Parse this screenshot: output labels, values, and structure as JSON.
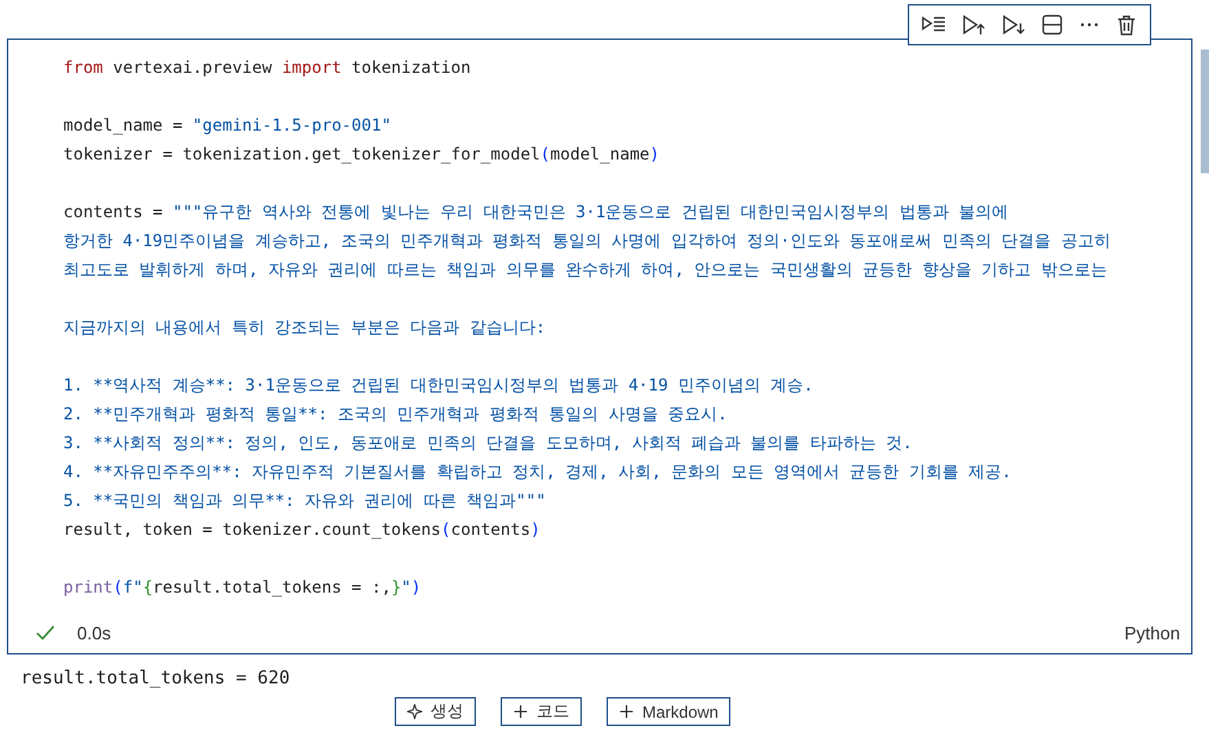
{
  "cell": {
    "lines": [
      {
        "kind": "code",
        "segments": [
          {
            "kind": "keyword",
            "text": "from"
          },
          {
            "kind": "plain",
            "text": " vertexai.preview "
          },
          {
            "kind": "keyword",
            "text": "import"
          },
          {
            "kind": "plain",
            "text": " tokenization"
          }
        ]
      },
      {
        "kind": "blank"
      },
      {
        "kind": "code",
        "segments": [
          {
            "kind": "plain",
            "text": "model_name = "
          },
          {
            "kind": "string",
            "text": "\"gemini-1.5-pro-001\""
          }
        ]
      },
      {
        "kind": "code",
        "segments": [
          {
            "kind": "plain",
            "text": "tokenizer = tokenization.get_tokenizer_for_model"
          },
          {
            "kind": "paren",
            "text": "("
          },
          {
            "kind": "plain",
            "text": "model_name"
          },
          {
            "kind": "paren",
            "text": ")"
          }
        ]
      },
      {
        "kind": "blank"
      },
      {
        "kind": "code",
        "segments": [
          {
            "kind": "plain",
            "text": "contents = "
          },
          {
            "kind": "string",
            "text": "\"\"\"유구한 역사와 전통에 빛나는 우리 대한국민은 3·1운동으로 건립된 대한민국임시정부의 법통과 불의에"
          }
        ]
      },
      {
        "kind": "code",
        "segments": [
          {
            "kind": "string",
            "text": "항거한 4·19민주이념을 계승하고, 조국의 민주개혁과 평화적 통일의 사명에 입각하여 정의·인도와 동포애로써 민족의 단결을 공고히"
          }
        ]
      },
      {
        "kind": "code",
        "segments": [
          {
            "kind": "string",
            "text": "최고도로 발휘하게 하며, 자유와 권리에 따르는 책임과 의무를 완수하게 하여, 안으로는 국민생활의 균등한 향상을 기하고 밖으로는"
          }
        ]
      },
      {
        "kind": "blank"
      },
      {
        "kind": "code",
        "segments": [
          {
            "kind": "string",
            "text": "지금까지의 내용에서 특히 강조되는 부분은 다음과 같습니다:"
          }
        ]
      },
      {
        "kind": "blank"
      },
      {
        "kind": "code",
        "segments": [
          {
            "kind": "string",
            "text": "1. **역사적 계승**: 3·1운동으로 건립된 대한민국임시정부의 법통과 4·19 민주이념의 계승."
          }
        ]
      },
      {
        "kind": "code",
        "segments": [
          {
            "kind": "string",
            "text": "2. **민주개혁과 평화적 통일**: 조국의 민주개혁과 평화적 통일의 사명을 중요시."
          }
        ]
      },
      {
        "kind": "code",
        "segments": [
          {
            "kind": "string",
            "text": "3. **사회적 정의**: 정의, 인도, 동포애로 민족의 단결을 도모하며, 사회적 폐습과 불의를 타파하는 것."
          }
        ]
      },
      {
        "kind": "code",
        "segments": [
          {
            "kind": "string",
            "text": "4. **자유민주주의**: 자유민주적 기본질서를 확립하고 정치, 경제, 사회, 문화의 모든 영역에서 균등한 기회를 제공."
          }
        ]
      },
      {
        "kind": "code",
        "segments": [
          {
            "kind": "string",
            "text": "5. **국민의 책임과 의무**: 자유와 권리에 따른 책임과\"\"\""
          }
        ]
      },
      {
        "kind": "code",
        "segments": [
          {
            "kind": "plain",
            "text": "result, token = tokenizer.count_tokens"
          },
          {
            "kind": "paren",
            "text": "("
          },
          {
            "kind": "plain",
            "text": "contents"
          },
          {
            "kind": "paren",
            "text": ")"
          }
        ]
      },
      {
        "kind": "blank"
      },
      {
        "kind": "code",
        "segments": [
          {
            "kind": "function",
            "text": "print"
          },
          {
            "kind": "paren",
            "text": "("
          },
          {
            "kind": "string",
            "text": "f\""
          },
          {
            "kind": "brace",
            "text": "{"
          },
          {
            "kind": "plain",
            "text": "result.total_tokens = :,"
          },
          {
            "kind": "brace",
            "text": "}"
          },
          {
            "kind": "string",
            "text": "\""
          },
          {
            "kind": "paren",
            "text": ")"
          }
        ]
      }
    ],
    "status": {
      "success": true,
      "duration": "0.0s",
      "language": "Python"
    }
  },
  "output": "result.total_tokens = 620",
  "add_buttons": [
    {
      "kind": "sparkle",
      "label": "생성"
    },
    {
      "kind": "plus",
      "label": "코드"
    },
    {
      "kind": "plus",
      "label": "Markdown"
    }
  ]
}
